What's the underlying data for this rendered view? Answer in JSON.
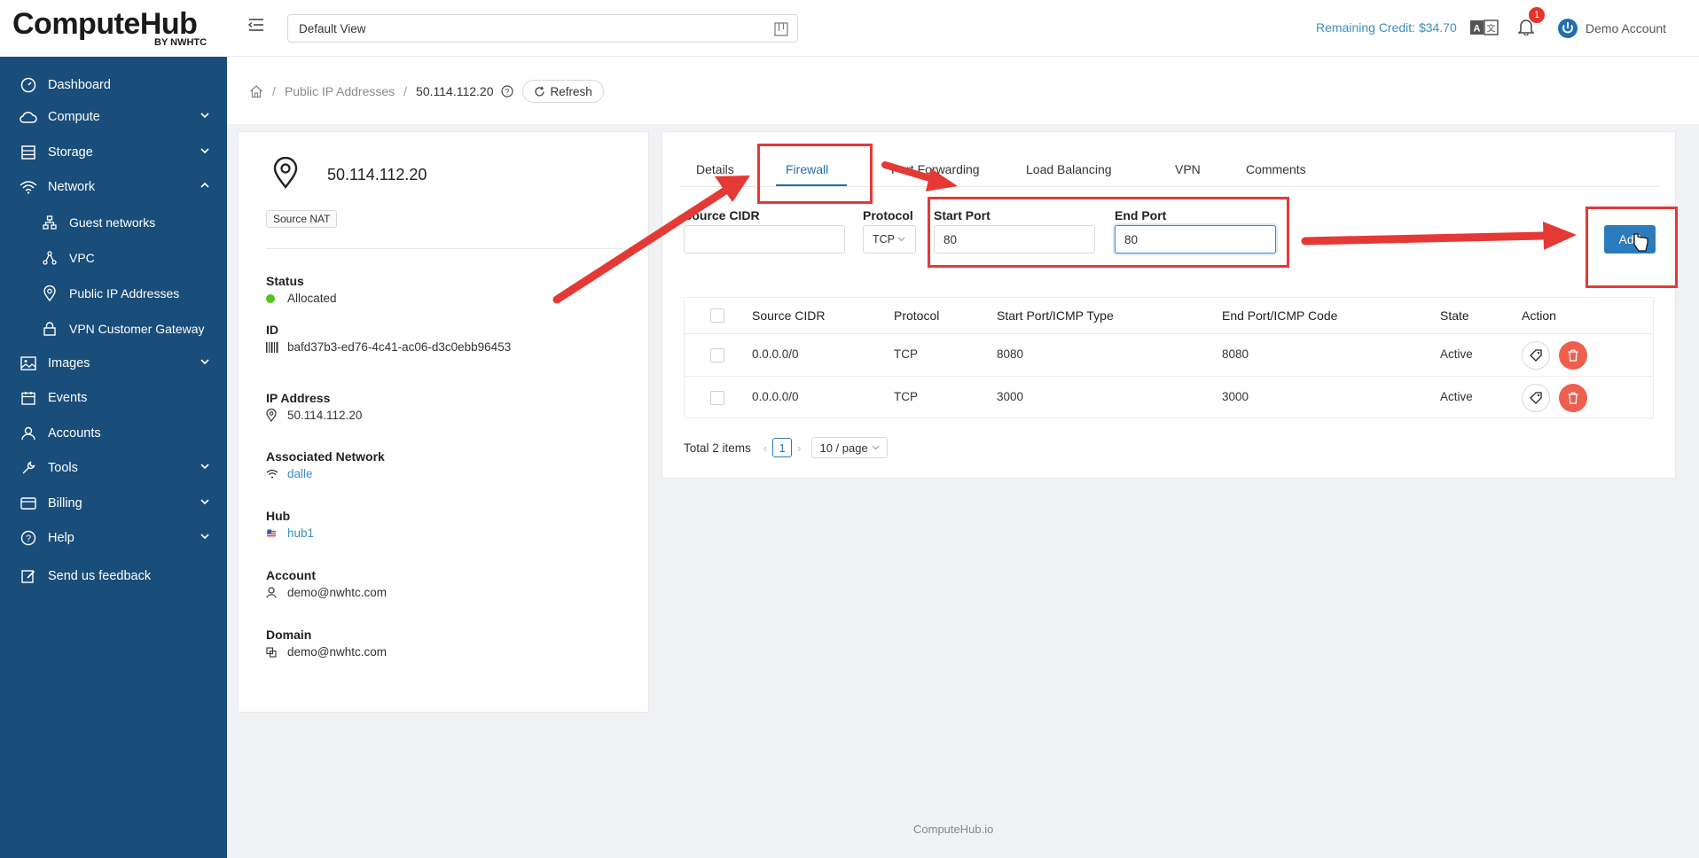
{
  "brand": {
    "name": "ComputeHub",
    "sub": "BY NWHTC"
  },
  "sidebar": {
    "items": [
      {
        "label": "Dashboard",
        "icon": "dashboard-icon"
      },
      {
        "label": "Compute",
        "icon": "cloud-icon"
      },
      {
        "label": "Storage",
        "icon": "storage-icon"
      },
      {
        "label": "Network",
        "icon": "wifi-icon"
      },
      {
        "label": "Guest networks",
        "icon": "network-tree-icon"
      },
      {
        "label": "VPC",
        "icon": "vpc-icon"
      },
      {
        "label": "Public IP Addresses",
        "icon": "location-icon"
      },
      {
        "label": "VPN Customer Gateway",
        "icon": "lock-icon"
      },
      {
        "label": "Images",
        "icon": "image-icon"
      },
      {
        "label": "Events",
        "icon": "calendar-icon"
      },
      {
        "label": "Accounts",
        "icon": "user-icon"
      },
      {
        "label": "Tools",
        "icon": "wrench-icon"
      },
      {
        "label": "Billing",
        "icon": "billing-icon"
      },
      {
        "label": "Help",
        "icon": "help-icon"
      },
      {
        "label": "Send us feedback",
        "icon": "edit-icon"
      }
    ]
  },
  "header": {
    "view_select": "Default View",
    "credit": "Remaining Credit: $34.70",
    "notif_count": "1",
    "account": "Demo Account"
  },
  "breadcrumb": {
    "section": "Public IP Addresses",
    "current": "50.114.112.20",
    "refresh": "Refresh"
  },
  "detail": {
    "title": "50.114.112.20",
    "tag": "Source NAT",
    "status_label": "Status",
    "status_value": "Allocated",
    "id_label": "ID",
    "id_value": "bafd37b3-ed76-4c41-ac06-d3c0ebb96453",
    "ip_label": "IP Address",
    "ip_value": "50.114.112.20",
    "network_label": "Associated Network",
    "network_value": "dalle",
    "hub_label": "Hub",
    "hub_value": "hub1",
    "account_label": "Account",
    "account_value": "demo@nwhtc.com",
    "domain_label": "Domain",
    "domain_value": "demo@nwhtc.com"
  },
  "tabs": [
    "Details",
    "Firewall",
    "Port Forwarding",
    "Load Balancing",
    "VPN",
    "Comments"
  ],
  "form": {
    "cidr_label": "Source CIDR",
    "cidr_value": "",
    "protocol_label": "Protocol",
    "protocol_value": "TCP",
    "start_label": "Start Port",
    "start_value": "80",
    "end_label": "End Port",
    "end_value": "80",
    "add": "Add"
  },
  "table": {
    "headers": [
      "Source CIDR",
      "Protocol",
      "Start Port/ICMP Type",
      "End Port/ICMP Code",
      "State",
      "Action"
    ],
    "rows": [
      {
        "cidr": "0.0.0.0/0",
        "protocol": "TCP",
        "start": "8080",
        "end": "8080",
        "state": "Active"
      },
      {
        "cidr": "0.0.0.0/0",
        "protocol": "TCP",
        "start": "3000",
        "end": "3000",
        "state": "Active"
      }
    ]
  },
  "pagination": {
    "total": "Total 2 items",
    "page": "1",
    "page_size": "10 / page"
  },
  "footer": "ComputeHub.io",
  "colors": {
    "sidebar": "#194d7a",
    "accent": "#2c7bbd",
    "link": "#3a8ec9",
    "annotation": "#e53935",
    "delete": "#ee5f4d"
  }
}
